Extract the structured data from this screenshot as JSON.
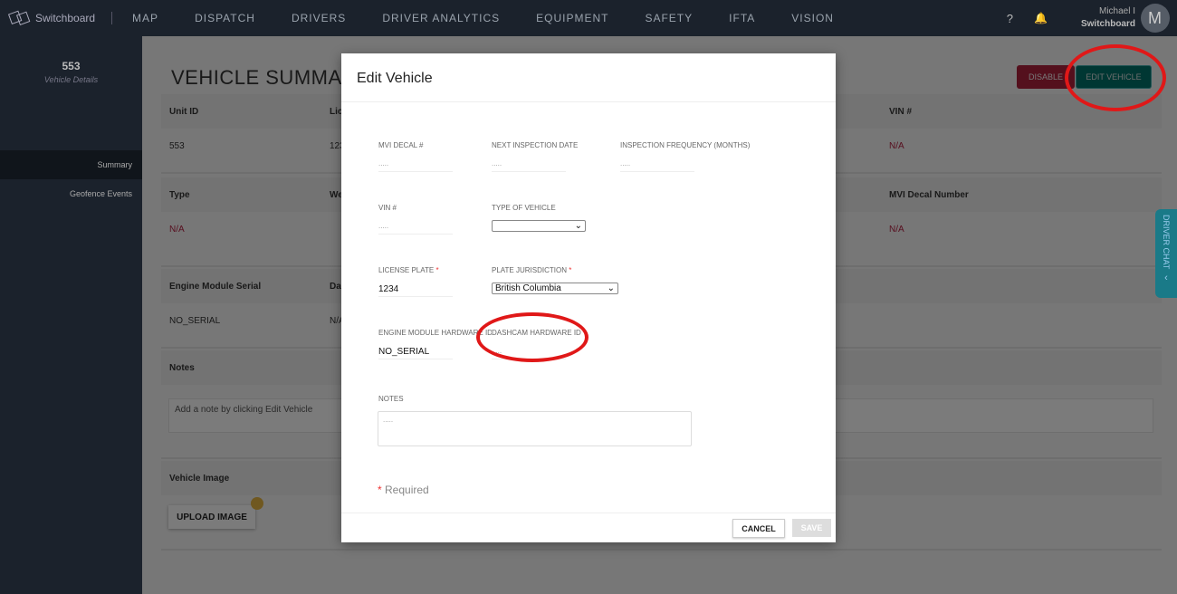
{
  "nav": {
    "brand": "Switchboard",
    "items": [
      "MAP",
      "DISPATCH",
      "DRIVERS",
      "DRIVER ANALYTICS",
      "EQUIPMENT",
      "SAFETY",
      "IFTA",
      "VISION"
    ],
    "help": "?",
    "user_name": "Michael I",
    "user_org": "Switchboard",
    "avatar": "M"
  },
  "sidebar": {
    "unit": "553",
    "subtitle": "Vehicle Details",
    "items": [
      "Summary",
      "Geofence Events"
    ]
  },
  "summary": {
    "title": "VEHICLE SUMMARY",
    "disable": "DISABLE",
    "edit": "EDIT VEHICLE",
    "row1": {
      "h1": "Unit ID",
      "v1": "553",
      "h2": "Lic",
      "v2": "123",
      "h5": "VIN #",
      "v5": "N/A"
    },
    "row2": {
      "h1": "Type",
      "v1": "N/A",
      "h2": "We",
      "h5": "MVI Decal Number",
      "v5": "N/A"
    },
    "row3": {
      "h1": "Engine Module Serial",
      "v1": "NO_SERIAL",
      "h2": "Da",
      "v2": "N/A"
    },
    "notes_h": "Notes",
    "notes_placeholder": "Add a note by clicking Edit Vehicle",
    "image_h": "Vehicle Image",
    "upload": "UPLOAD IMAGE"
  },
  "driver_chat": "DRIVER CHAT",
  "modal": {
    "title": "Edit Vehicle",
    "mvi": {
      "label": "MVI DECAL #",
      "value": "....."
    },
    "next_insp": {
      "label": "NEXT INSPECTION DATE",
      "value": "....."
    },
    "insp_freq": {
      "label": "INSPECTION FREQUENCY (MONTHS)",
      "value": "....."
    },
    "vin": {
      "label": "VIN #",
      "value": "....."
    },
    "type": {
      "label": "TYPE OF VEHICLE",
      "value": ""
    },
    "plate": {
      "label": "LICENSE PLATE",
      "value": "1234"
    },
    "jurisdiction": {
      "label": "PLATE JURISDICTION",
      "value": "British Columbia"
    },
    "engine": {
      "label": "ENGINE MODULE HARDWARE ID",
      "value": "NO_SERIAL"
    },
    "dashcam": {
      "label": "DASHCAM HARDWARE ID",
      "value": "....."
    },
    "notes": {
      "label": "NOTES",
      "value": "....."
    },
    "asterisk": "*",
    "required": "Required",
    "cancel": "CANCEL",
    "save": "SAVE"
  },
  "colors": {
    "accent": "#006e66",
    "danger": "#a8203a",
    "annotation": "#e01818"
  }
}
